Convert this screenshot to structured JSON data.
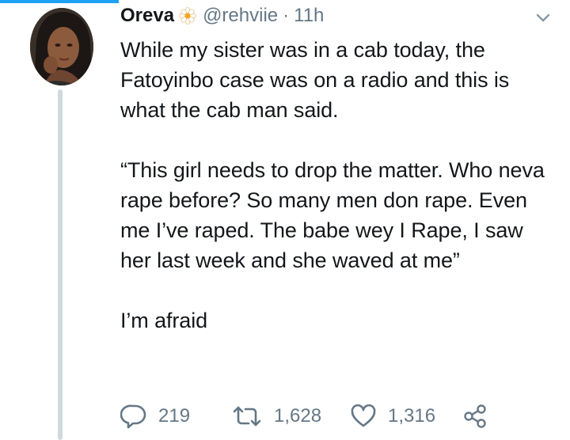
{
  "tweet": {
    "display_name": "Oreva",
    "handle": "@rehviie",
    "separator": "·",
    "time": "11h",
    "text": "While my sister was in a cab today, the Fatoyinbo case was on a radio and this is what the cab man said.\n\n“This girl needs to drop the matter. Who neva rape before? So many men don rape. Even me I’ve raped. The babe wey I Rape, I saw her last week and she waved at me”\n\nI’m afraid",
    "actions": {
      "reply_count": "219",
      "retweet_count": "1,628",
      "like_count": "1,316"
    },
    "icons": {
      "name_emoji": "flower-icon",
      "menu": "chevron-down-icon",
      "reply": "reply-icon",
      "retweet": "retweet-icon",
      "like": "heart-icon",
      "share": "share-icon"
    }
  },
  "colors": {
    "accent": "#1da1f2",
    "text": "#14171a",
    "secondary": "#657786",
    "thread_line": "#cfd9de"
  }
}
